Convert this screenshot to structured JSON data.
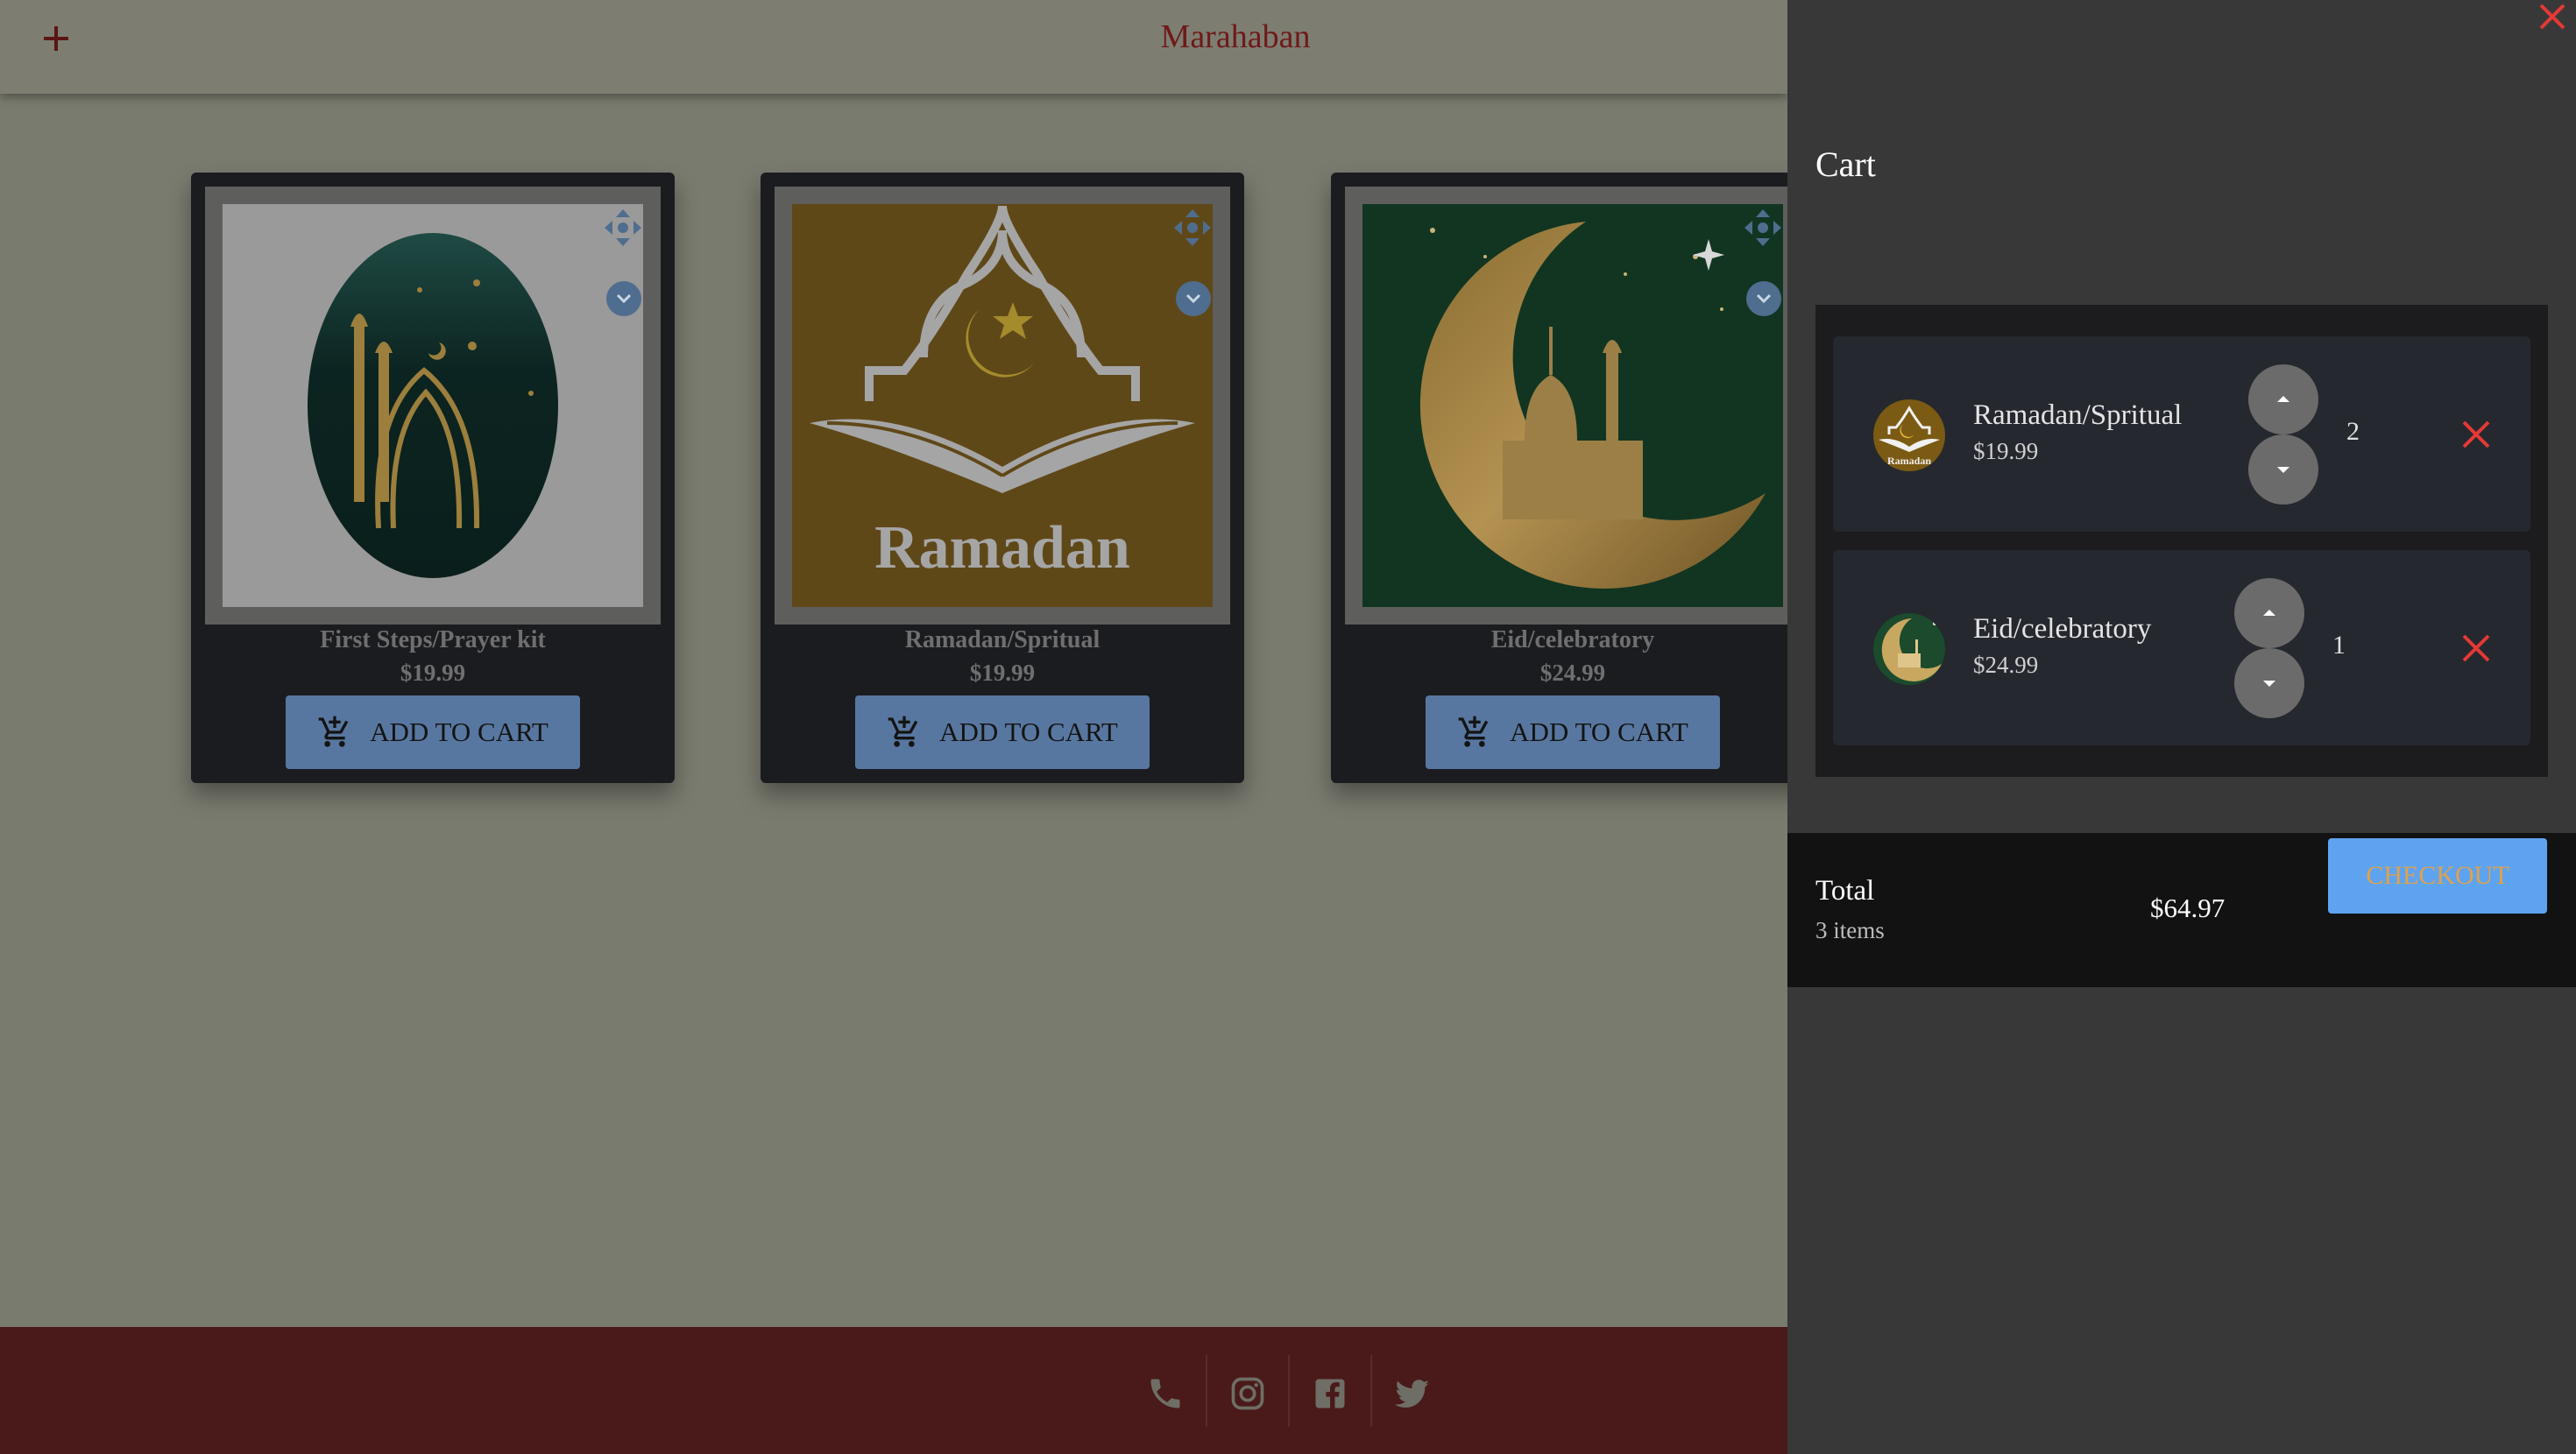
{
  "header": {
    "brand": "Marahaban",
    "add_icon": "plus-icon"
  },
  "products": [
    {
      "title": "First Steps/Prayer kit",
      "price": "$19.99",
      "button_label": "ADD TO CART"
    },
    {
      "title": "Ramadan/Spritual",
      "price": "$19.99",
      "button_label": "ADD TO CART",
      "image_text": "Ramadan"
    },
    {
      "title": "Eid/celebratory",
      "price": "$24.99",
      "button_label": "ADD TO CART"
    }
  ],
  "footer": {
    "icons": [
      "phone-icon",
      "instagram-icon",
      "facebook-icon",
      "twitter-icon"
    ]
  },
  "cart": {
    "title": "Cart",
    "items": [
      {
        "name": "Ramadan/Spritual",
        "price": "$19.99",
        "quantity": "2",
        "thumb_text": "Ramadan"
      },
      {
        "name": "Eid/celebratory",
        "price": "$24.99",
        "quantity": "1"
      }
    ],
    "total_label": "Total",
    "item_count": "3 items",
    "total_amount": "$64.97",
    "checkout_label": "CHECKOUT"
  },
  "colors": {
    "accent_red": "#e53935",
    "checkout_blue": "#5ea3f0",
    "header_red": "#6e1a1a",
    "footer": "#4a1919"
  }
}
